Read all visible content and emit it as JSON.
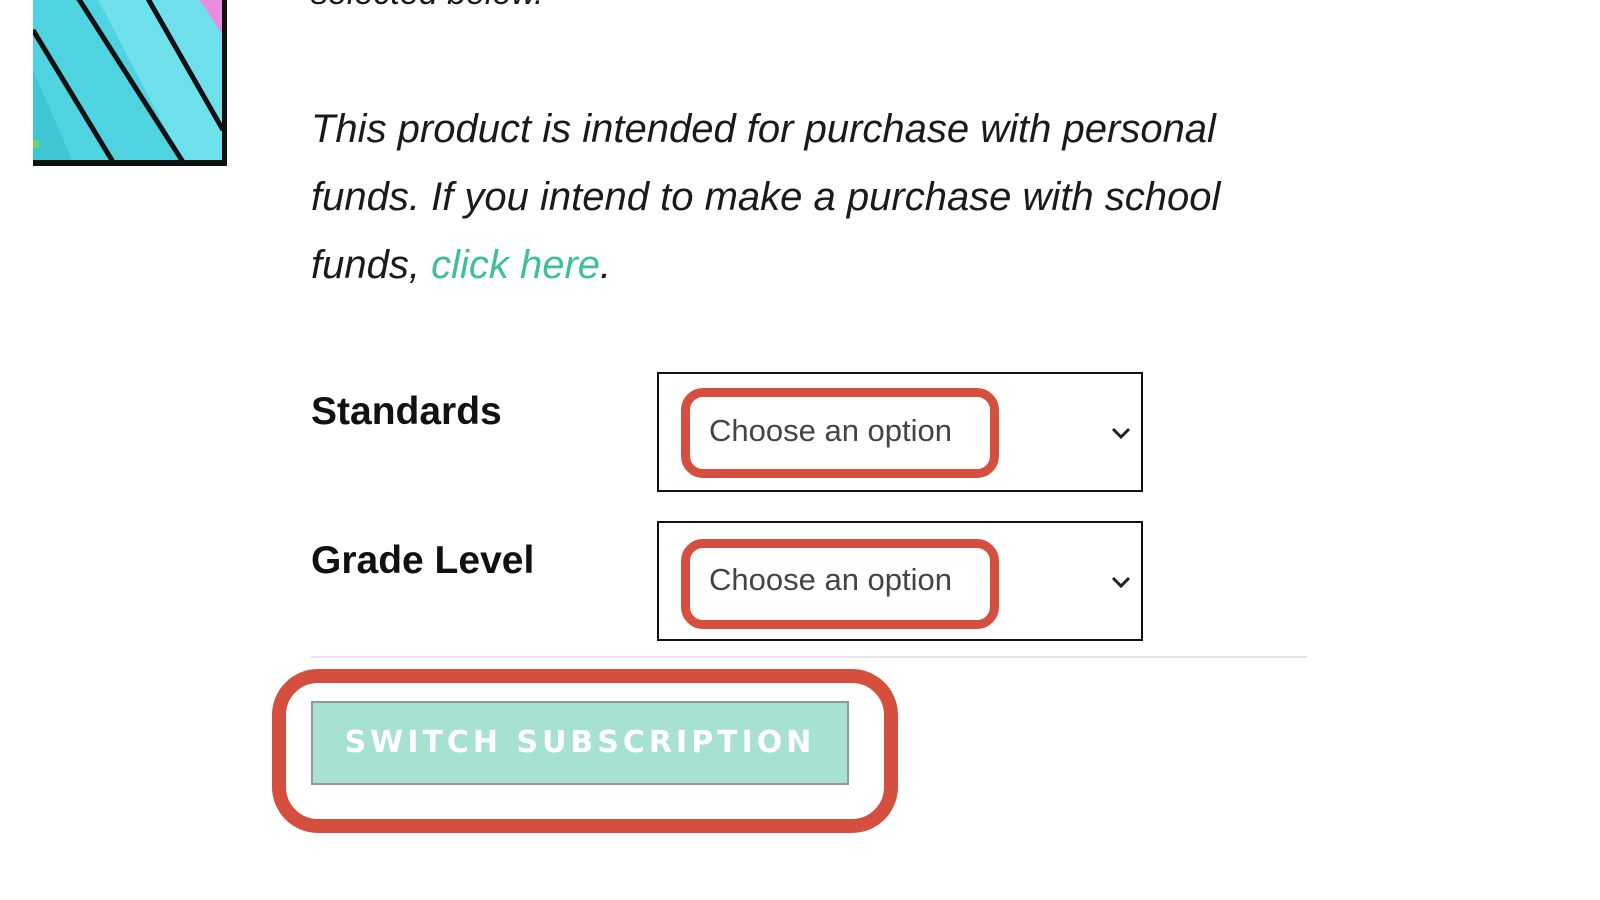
{
  "header": {
    "cut_text": "selected below."
  },
  "notice": {
    "text_before": "This product is intended for purchase with personal funds. If you intend to make a purchase with school funds, ",
    "link_text": "click here",
    "text_after": "."
  },
  "options": {
    "standards": {
      "label": "Standards",
      "value": "Choose an option",
      "icon": "chevron-down-icon"
    },
    "grade_level": {
      "label": "Grade Level",
      "value": "Choose an option",
      "icon": "chevron-down-icon"
    }
  },
  "actions": {
    "switch_label": "SWITCH SUBSCRIPTION"
  },
  "colors": {
    "link": "#3dbf9c",
    "highlight": "#d44f3e",
    "button_bg": "#a6e1d3"
  }
}
